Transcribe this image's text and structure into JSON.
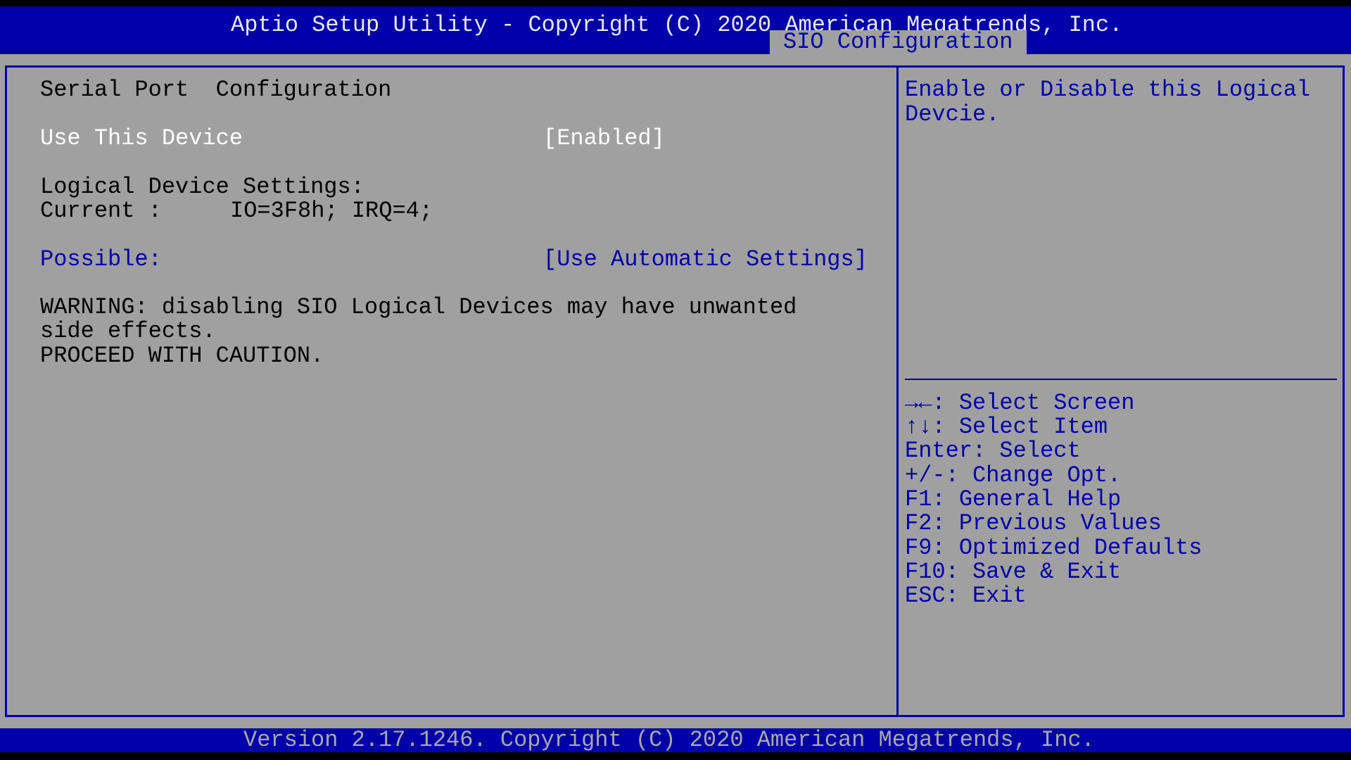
{
  "header": {
    "title": "Aptio Setup Utility - Copyright (C) 2020 American Megatrends, Inc.",
    "active_tab": "SIO Configuration"
  },
  "main": {
    "section_title": "Serial Port  Configuration",
    "use_device": {
      "label": "Use This Device",
      "value": "[Enabled]"
    },
    "logical_settings_label": "Logical Device Settings:",
    "current": {
      "label": "Current :",
      "value": "IO=3F8h; IRQ=4;"
    },
    "possible": {
      "label": "Possible:",
      "value": "[Use Automatic Settings]"
    },
    "warning": [
      "WARNING: disabling SIO Logical Devices may have unwanted",
      "side effects.",
      "PROCEED WITH CAUTION."
    ]
  },
  "help": {
    "description": [
      "Enable or Disable this Logical",
      "Devcie."
    ],
    "keys": [
      {
        "key": "→←",
        "label": ": Select Screen",
        "icon": "left-right-arrows-icon"
      },
      {
        "key": "↑↓",
        "label": ": Select Item",
        "icon": "up-down-arrows-icon"
      },
      {
        "key": "",
        "label": "Enter: Select"
      },
      {
        "key": "",
        "label": "+/-: Change Opt."
      },
      {
        "key": "",
        "label": "F1: General Help"
      },
      {
        "key": "",
        "label": "F2: Previous Values"
      },
      {
        "key": "",
        "label": "F9: Optimized Defaults"
      },
      {
        "key": "",
        "label": "F10: Save & Exit"
      },
      {
        "key": "",
        "label": "ESC: Exit"
      }
    ]
  },
  "footer": {
    "text": "Version 2.17.1246. Copyright (C) 2020 American Megatrends, Inc."
  },
  "colors": {
    "blue": "#0000a8",
    "background": "#a0a0a0",
    "selected_text": "#ffffff"
  }
}
